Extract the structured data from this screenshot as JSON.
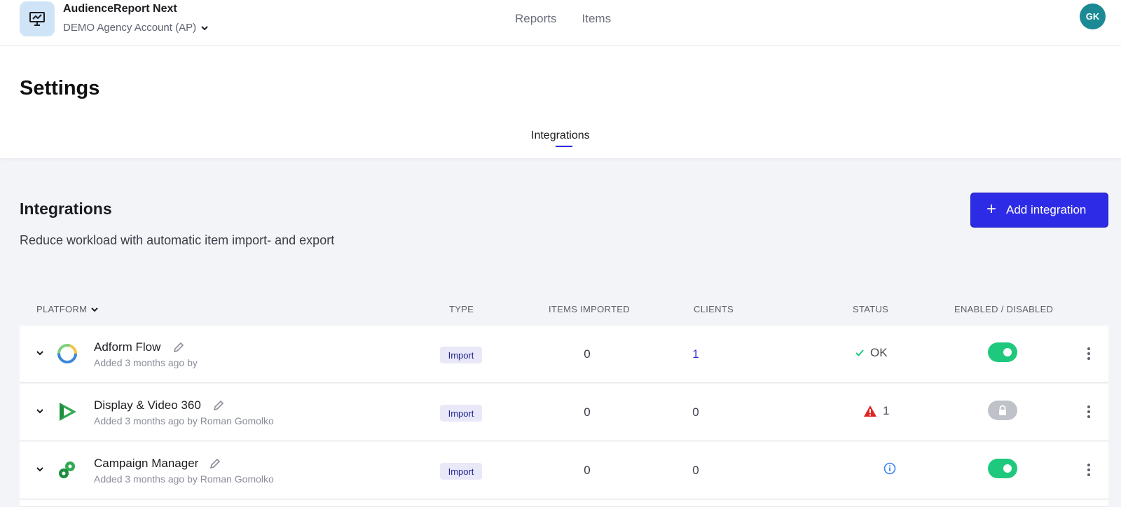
{
  "header": {
    "app_name": "AudienceReport Next",
    "account": "DEMO Agency Account (AP)",
    "nav": [
      "Reports",
      "Items"
    ],
    "avatar_initials": "GK"
  },
  "settings": {
    "title": "Settings",
    "tabs": [
      "Integrations"
    ]
  },
  "section": {
    "title": "Integrations",
    "subtitle": "Reduce workload with automatic item import- and export",
    "add_button": "Add integration"
  },
  "table": {
    "columns": {
      "platform": "PLATFORM",
      "type": "TYPE",
      "items_imported": "ITEMS IMPORTED",
      "clients": "CLIENTS",
      "status": "STATUS",
      "enabled": "ENABLED / DISABLED"
    },
    "rows": [
      {
        "name": "Adform Flow",
        "added": "Added 3 months ago by",
        "type": "Import",
        "items_imported": "0",
        "clients": "1",
        "status_icon": "check-icon",
        "status_text": "OK",
        "enabled": "on",
        "icon": "adform-icon"
      },
      {
        "name": "Display & Video 360",
        "added": "Added 3 months ago by Roman Gomolko",
        "type": "Import",
        "items_imported": "0",
        "clients": "0",
        "status_icon": "warning-icon",
        "status_text": "1",
        "enabled": "locked",
        "icon": "dv360-icon"
      },
      {
        "name": "Campaign Manager",
        "added": "Added 3 months ago by Roman Gomolko",
        "type": "Import",
        "items_imported": "0",
        "clients": "0",
        "status_icon": "info-icon",
        "status_text": "",
        "enabled": "on",
        "icon": "campaign-manager-icon"
      }
    ]
  },
  "colors": {
    "primary": "#2e2be6",
    "toggle_on": "#1ec97e",
    "toggle_locked": "#bfc2c8",
    "status_ok": "#1ec97e",
    "status_warning": "#e02424",
    "status_info": "#3b82f6",
    "avatar": "#1b8a94"
  }
}
